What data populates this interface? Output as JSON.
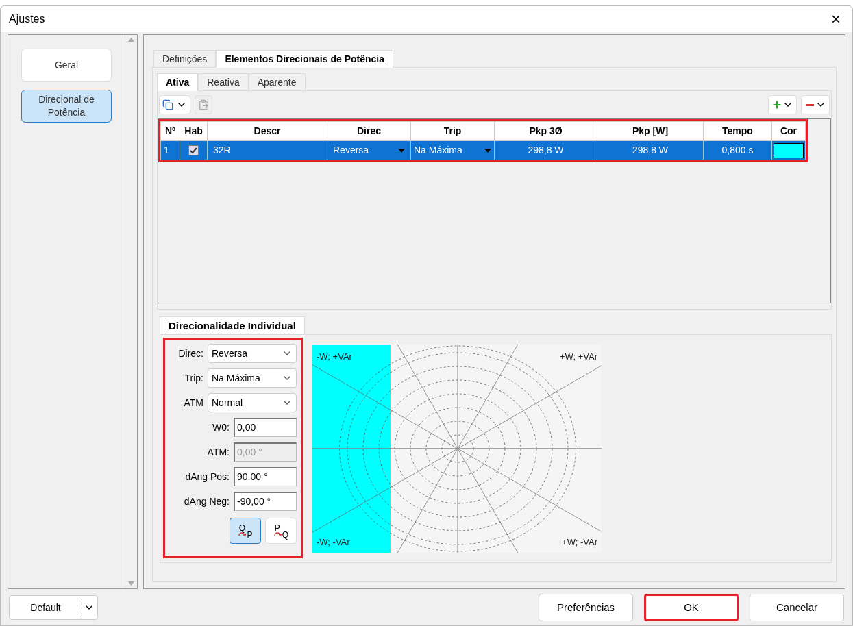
{
  "window": {
    "title": "Ajustes",
    "close": "×"
  },
  "sidebar": {
    "items": [
      {
        "label": "Geral",
        "selected": false
      },
      {
        "label": "Direcional de Potência",
        "selected": true
      }
    ]
  },
  "main_tabs": [
    {
      "label": "Definições",
      "selected": false
    },
    {
      "label": "Elementos Direcionais de Potência",
      "selected": true
    }
  ],
  "sub_tabs": [
    {
      "label": "Ativa",
      "selected": true
    },
    {
      "label": "Reativa",
      "selected": false
    },
    {
      "label": "Aparente",
      "selected": false
    }
  ],
  "table": {
    "highlighted": true,
    "columns": [
      "Nº",
      "Hab",
      "Descr",
      "Direc",
      "Trip",
      "Pkp 3Ø",
      "Pkp [W]",
      "Tempo",
      "Cor"
    ],
    "rows": [
      {
        "selected": true,
        "number": "1",
        "enabled": true,
        "descr": "32R",
        "direc": "Reversa",
        "trip": "Na Máxima",
        "pkp3": "298,8 W",
        "pkpw": "298,8 W",
        "tempo": "0,800 s",
        "color": "#00ffff"
      }
    ]
  },
  "individual": {
    "title": "Direcionalidade Individual",
    "highlighted": true,
    "fields": [
      {
        "kind": "select",
        "label": "Direc:",
        "value": "Reversa"
      },
      {
        "kind": "select",
        "label": "Trip:",
        "value": "Na Máxima"
      },
      {
        "kind": "select",
        "label": "ATM",
        "value": "Normal"
      },
      {
        "kind": "input",
        "label": "W0:",
        "value": "0,00",
        "disabled": false
      },
      {
        "kind": "input",
        "label": "ATM:",
        "value": "0,00 °",
        "disabled": true
      },
      {
        "kind": "input",
        "label": "dAng Pos:",
        "value": "90,00 °",
        "disabled": false
      },
      {
        "kind": "input",
        "label": "dAng Neg:",
        "value": "-90,00 °",
        "disabled": false
      }
    ],
    "axis_buttons": [
      {
        "selected": true,
        "top": "Q",
        "side": "P"
      },
      {
        "selected": false,
        "top": "P",
        "side": "Q"
      }
    ],
    "quadrants": [
      "-W; +VAr",
      "+W; +VAr",
      "-W; -VAr",
      "+W; -VAr"
    ]
  },
  "footer": {
    "preset": "Default",
    "buttons": [
      {
        "label": "Preferências",
        "highlighted": false
      },
      {
        "label": "OK",
        "highlighted": true
      },
      {
        "label": "Cancelar",
        "highlighted": false
      }
    ]
  }
}
